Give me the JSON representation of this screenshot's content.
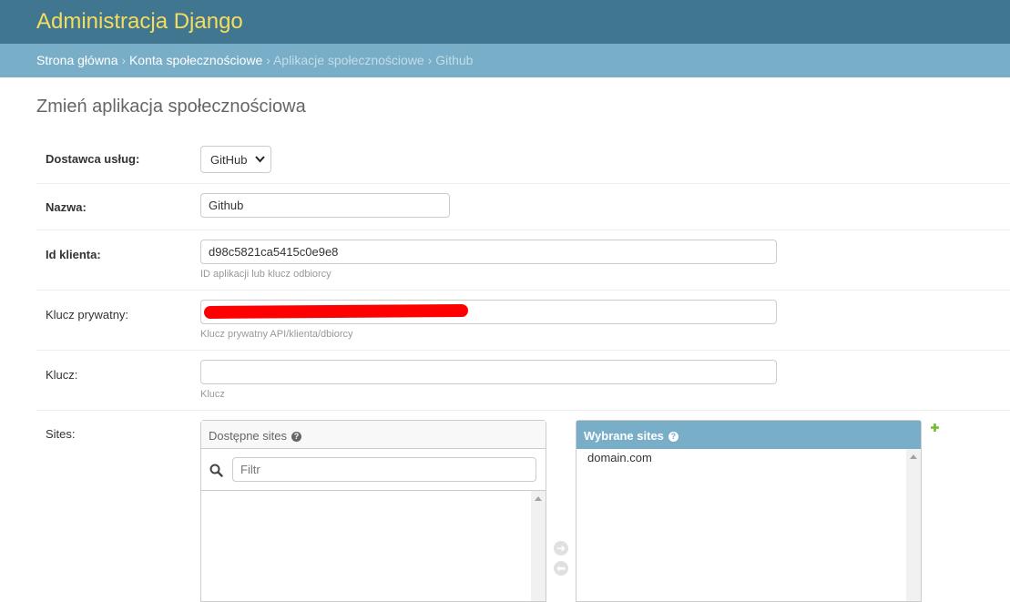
{
  "header": {
    "site_name": "Administracja Django"
  },
  "breadcrumbs": {
    "items": [
      "Strona główna",
      "Konta społecznościowe",
      "Aplikacje społecznościowe",
      "Github"
    ],
    "separator": "›"
  },
  "page_title": "Zmień aplikacja społecznościowa",
  "form": {
    "provider": {
      "label": "Dostawca usług:",
      "value": "GitHub"
    },
    "name": {
      "label": "Nazwa:",
      "value": "Github"
    },
    "client_id": {
      "label": "Id klienta:",
      "value": "d98c5821ca5415c0e9e8",
      "help": "ID aplikacji lub klucz odbiorcy"
    },
    "secret": {
      "label": "Klucz prywatny:",
      "value": "",
      "help": "Klucz prywatny API/klienta/dbiorcy"
    },
    "key": {
      "label": "Klucz:",
      "value": "",
      "help": "Klucz"
    },
    "sites": {
      "label": "Sites:",
      "available_title": "Dostępne sites",
      "filter_placeholder": "Filtr",
      "chosen_title": "Wybrane sites",
      "chosen_items": [
        "domain.com"
      ]
    }
  },
  "colors": {
    "header_bg": "#417690",
    "site_name": "#f5dd5d",
    "breadcrumbs_bg": "#79aec8",
    "add_icon": "#70bf2b",
    "redaction": "#ff0000"
  }
}
